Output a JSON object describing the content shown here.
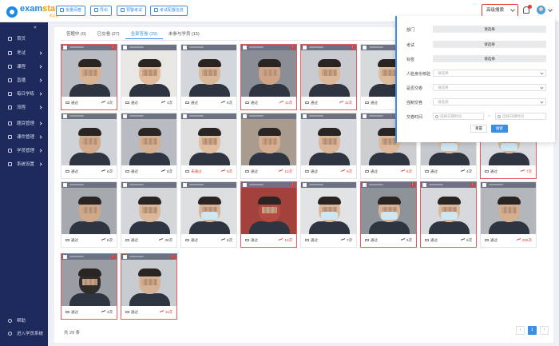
{
  "app": {
    "logo_text": "exam",
    "logo_text2": "star",
    "logo_sub": "考试星"
  },
  "toolbar": [
    {
      "label": "批量阅卷"
    },
    {
      "label": "导出"
    },
    {
      "label": "预警考试"
    },
    {
      "label": "考试配置信息"
    }
  ],
  "header": {
    "advanced_search": "高级搜索"
  },
  "sidebar": {
    "collapse": "«",
    "items": [
      {
        "label": "首页"
      },
      {
        "label": "考试",
        "chevron": true
      },
      {
        "label": "课程",
        "chevron": true
      },
      {
        "label": "直播",
        "chevron": true
      },
      {
        "label": "每日学练",
        "chevron": true
      },
      {
        "label": "流程",
        "chevron": true
      },
      {
        "label": "题目管理",
        "chevron": true
      },
      {
        "label": "课件管理",
        "chevron": true
      },
      {
        "label": "学员管理",
        "chevron": true
      },
      {
        "label": "系统设置",
        "chevron": true
      }
    ],
    "bottom": [
      {
        "label": "帮助"
      },
      {
        "label": "进入学员系统"
      }
    ]
  },
  "tabs": [
    {
      "label": "答题中 (0)",
      "active": false
    },
    {
      "label": "已交卷 (27)",
      "active": false
    },
    {
      "label": "全部答卷 (29)",
      "active": true
    },
    {
      "label": "未参与学员 (15)",
      "active": false
    }
  ],
  "cards": [
    {
      "status": "通过",
      "count": "4次",
      "warn": false,
      "flag": true,
      "bg": "#b9bcc2",
      "face": "#d8b293"
    },
    {
      "status": "通过",
      "count": "4次",
      "warn": false,
      "flag": false,
      "bg": "#e9e7e4",
      "face": "#e0bb9c"
    },
    {
      "status": "通过",
      "count": "6次",
      "warn": false,
      "flag": false,
      "bg": "#d3d6da",
      "face": "#d9b89a"
    },
    {
      "status": "通过",
      "count": "11次",
      "warn": true,
      "flag": true,
      "bg": "#8b8e96",
      "face": "#cfa486"
    },
    {
      "status": "通过",
      "count": "11次",
      "warn": true,
      "flag": true,
      "bg": "#c9cbd0",
      "face": "#dcb798"
    },
    {
      "status": "通过",
      "count": "8次",
      "warn": false,
      "flag": false,
      "bg": "#d7dadd",
      "face": "#dfbb9d"
    },
    {
      "status": "通过",
      "count": "6次",
      "warn": false,
      "flag": true,
      "bg": "#9ea3aa",
      "face": "#d4b092"
    },
    {
      "status": "未通过",
      "count": "18次",
      "warn": true,
      "flag": false,
      "bg": "#c2c5ca",
      "face": "#d6b597"
    },
    {
      "status": "通过",
      "count": "6次",
      "warn": false,
      "flag": false,
      "bg": "#cfd2d6",
      "face": "#d1ab8c"
    },
    {
      "status": "通过",
      "count": "8次",
      "warn": false,
      "flag": false,
      "bg": "#b8bcc2",
      "face": "#d5b194"
    },
    {
      "status": "未通过",
      "count": "9次",
      "warn": true,
      "flag": false,
      "bg": "#dedede",
      "face": "#e0bd9f"
    },
    {
      "status": "通过",
      "count": "12次",
      "warn": true,
      "flag": false,
      "bg": "#a89c8e",
      "face": "#d4ae8e"
    },
    {
      "status": "通过",
      "count": "9次",
      "warn": true,
      "flag": false,
      "bg": "#d6d8db",
      "face": "#d9b697"
    },
    {
      "status": "通过",
      "count": "8次",
      "warn": true,
      "flag": false,
      "bg": "#ccced2",
      "face": "#dcb99b"
    },
    {
      "status": "通过",
      "count": "4次",
      "warn": false,
      "flag": false,
      "bg": "#c5c8cc",
      "face": "#dcb798",
      "mask": true
    },
    {
      "status": "通过",
      "count": "7次",
      "warn": true,
      "flag": true,
      "bg": "#d9dce0",
      "face": "#d8b496",
      "mask": true
    },
    {
      "status": "通过",
      "count": "8次",
      "warn": false,
      "flag": false,
      "bg": "#a6a9ae",
      "face": "#cfa98a"
    },
    {
      "status": "通过",
      "count": "30次",
      "warn": false,
      "flag": false,
      "bg": "#d4d6d9",
      "face": "#dbb89a"
    },
    {
      "status": "通过",
      "count": "8次",
      "warn": false,
      "flag": false,
      "bg": "#dcdee0",
      "face": "#d8b496",
      "mask": true
    },
    {
      "status": "通过",
      "count": "10次",
      "warn": true,
      "flag": true,
      "bg": "#a3423c",
      "face": "#b44a42"
    },
    {
      "status": "通过",
      "count": "7次",
      "warn": false,
      "flag": false,
      "bg": "#e2e3e5",
      "face": "#dcb99b",
      "mask": true
    },
    {
      "status": "通过",
      "count": "6次",
      "warn": false,
      "flag": true,
      "bg": "#8e9299",
      "face": "#d9b596",
      "mask": true
    },
    {
      "status": "通过",
      "count": "6次",
      "warn": false,
      "flag": true,
      "bg": "#d7d9dc",
      "face": "#dcb99b",
      "mask": true
    },
    {
      "status": "通过",
      "count": "259次",
      "warn": true,
      "flag": false,
      "bg": "#b3b6bb",
      "face": "#d3ae90"
    },
    {
      "status": "通过",
      "count": "3次",
      "warn": false,
      "flag": true,
      "bg": "#9a9da3",
      "face": "#2f2c2b"
    },
    {
      "status": "通过",
      "count": "11次",
      "warn": true,
      "flag": true,
      "bg": "#c8cbd0",
      "face": "#d6b294"
    }
  ],
  "footer": {
    "total": "共 29 条"
  },
  "pager": {
    "prev": "‹",
    "current": "1",
    "next": "›"
  },
  "panel": {
    "dept_label": "部门",
    "dept_value": "请选择",
    "exam_label": "考试",
    "exam_value": "请选择",
    "group_label": "标签",
    "group_value": "请选择",
    "face_label": "人脸身份核验",
    "face_value": "请选择",
    "submit_label": "是否交卷",
    "submit_value": "请选择",
    "force_label": "强制交卷",
    "force_value": "请选择",
    "time_label": "交卷时间",
    "start_placeholder": "选择日期时间",
    "end_placeholder": "选择日期时间",
    "dash": "~",
    "reset": "重置",
    "search": "搜索"
  }
}
